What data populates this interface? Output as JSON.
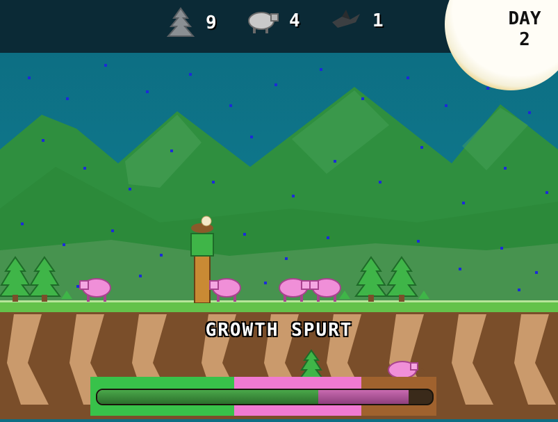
{
  "hud": {
    "trees_icon": "pine-tree-icon",
    "trees_count": "9",
    "sheep_icon": "sheep-icon",
    "sheep_count": "4",
    "crows_icon": "crow-icon",
    "crows_count": "1"
  },
  "day": {
    "label": "DAY",
    "number": "2"
  },
  "event": {
    "title": "GROWTH SPURT"
  },
  "growth_bar": {
    "segment_colors": [
      "#38c24a",
      "#f07ad2",
      "#a0622e"
    ],
    "green_progress": 0.66,
    "pink_progress": 0.93
  },
  "colors": {
    "sky": "#0d6e84",
    "mountain": "#2f8f3f",
    "sheep": "#f08fd8",
    "tree": "#3fb548"
  }
}
